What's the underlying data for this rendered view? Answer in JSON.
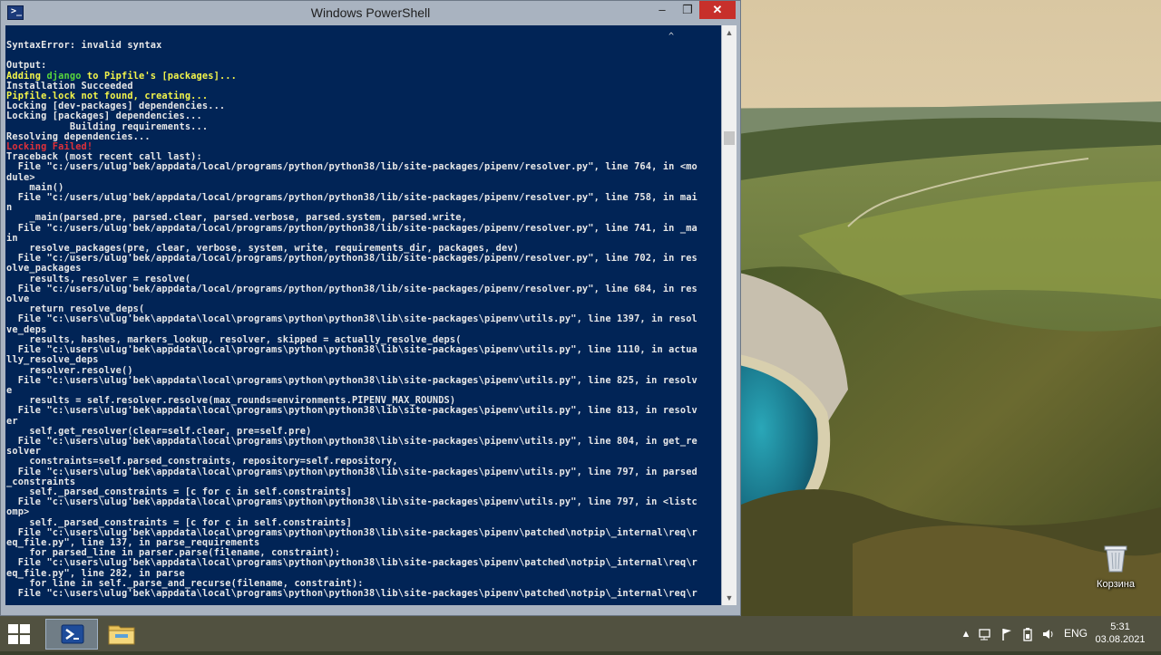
{
  "window": {
    "title": "Windows PowerShell",
    "minimize": "–",
    "maximize": "❐",
    "close": "✕"
  },
  "console": {
    "caret": "^",
    "lines": [
      {
        "text": "SyntaxError: invalid syntax",
        "color": "white"
      },
      {
        "text": "",
        "color": "white"
      },
      {
        "text": "Output:",
        "color": "white"
      },
      {
        "parts": [
          {
            "text": "Adding ",
            "color": "yellow"
          },
          {
            "text": "django",
            "color": "green"
          },
          {
            "text": " to Pipfile's [packages]...",
            "color": "yellow"
          }
        ]
      },
      {
        "text": "Installation Succeeded",
        "color": "white"
      },
      {
        "text": "Pipfile.lock not found, creating...",
        "color": "yellow"
      },
      {
        "text": "Locking [dev-packages] dependencies...",
        "color": "white"
      },
      {
        "text": "Locking [packages] dependencies...",
        "color": "white"
      },
      {
        "text": "           Building requirements...",
        "color": "white"
      },
      {
        "text": "Resolving dependencies...",
        "color": "white"
      },
      {
        "text": "Locking Failed!",
        "color": "red"
      },
      {
        "text": "Traceback (most recent call last):",
        "color": "white"
      },
      {
        "text": "  File \"c:/users/ulug'bek/appdata/local/programs/python/python38/lib/site-packages/pipenv/resolver.py\", line 764, in <mo",
        "color": "white"
      },
      {
        "text": "dule>",
        "color": "white"
      },
      {
        "text": "    main()",
        "color": "white"
      },
      {
        "text": "  File \"c:/users/ulug'bek/appdata/local/programs/python/python38/lib/site-packages/pipenv/resolver.py\", line 758, in mai",
        "color": "white"
      },
      {
        "text": "n",
        "color": "white"
      },
      {
        "text": "    _main(parsed.pre, parsed.clear, parsed.verbose, parsed.system, parsed.write,",
        "color": "white"
      },
      {
        "text": "  File \"c:/users/ulug'bek/appdata/local/programs/python/python38/lib/site-packages/pipenv/resolver.py\", line 741, in _ma",
        "color": "white"
      },
      {
        "text": "in",
        "color": "white"
      },
      {
        "text": "    resolve_packages(pre, clear, verbose, system, write, requirements_dir, packages, dev)",
        "color": "white"
      },
      {
        "text": "  File \"c:/users/ulug'bek/appdata/local/programs/python/python38/lib/site-packages/pipenv/resolver.py\", line 702, in res",
        "color": "white"
      },
      {
        "text": "olve_packages",
        "color": "white"
      },
      {
        "text": "    results, resolver = resolve(",
        "color": "white"
      },
      {
        "text": "  File \"c:/users/ulug'bek/appdata/local/programs/python/python38/lib/site-packages/pipenv/resolver.py\", line 684, in res",
        "color": "white"
      },
      {
        "text": "olve",
        "color": "white"
      },
      {
        "text": "    return resolve_deps(",
        "color": "white"
      },
      {
        "text": "  File \"c:\\users\\ulug'bek\\appdata\\local\\programs\\python\\python38\\lib\\site-packages\\pipenv\\utils.py\", line 1397, in resol",
        "color": "white"
      },
      {
        "text": "ve_deps",
        "color": "white"
      },
      {
        "text": "    results, hashes, markers_lookup, resolver, skipped = actually_resolve_deps(",
        "color": "white"
      },
      {
        "text": "  File \"c:\\users\\ulug'bek\\appdata\\local\\programs\\python\\python38\\lib\\site-packages\\pipenv\\utils.py\", line 1110, in actua",
        "color": "white"
      },
      {
        "text": "lly_resolve_deps",
        "color": "white"
      },
      {
        "text": "    resolver.resolve()",
        "color": "white"
      },
      {
        "text": "  File \"c:\\users\\ulug'bek\\appdata\\local\\programs\\python\\python38\\lib\\site-packages\\pipenv\\utils.py\", line 825, in resolv",
        "color": "white"
      },
      {
        "text": "e",
        "color": "white"
      },
      {
        "text": "    results = self.resolver.resolve(max_rounds=environments.PIPENV_MAX_ROUNDS)",
        "color": "white"
      },
      {
        "text": "  File \"c:\\users\\ulug'bek\\appdata\\local\\programs\\python\\python38\\lib\\site-packages\\pipenv\\utils.py\", line 813, in resolv",
        "color": "white"
      },
      {
        "text": "er",
        "color": "white"
      },
      {
        "text": "    self.get_resolver(clear=self.clear, pre=self.pre)",
        "color": "white"
      },
      {
        "text": "  File \"c:\\users\\ulug'bek\\appdata\\local\\programs\\python\\python38\\lib\\site-packages\\pipenv\\utils.py\", line 804, in get_re",
        "color": "white"
      },
      {
        "text": "solver",
        "color": "white"
      },
      {
        "text": "    constraints=self.parsed_constraints, repository=self.repository,",
        "color": "white"
      },
      {
        "text": "  File \"c:\\users\\ulug'bek\\appdata\\local\\programs\\python\\python38\\lib\\site-packages\\pipenv\\utils.py\", line 797, in parsed",
        "color": "white"
      },
      {
        "text": "_constraints",
        "color": "white"
      },
      {
        "text": "    self._parsed_constraints = [c for c in self.constraints]",
        "color": "white"
      },
      {
        "text": "  File \"c:\\users\\ulug'bek\\appdata\\local\\programs\\python\\python38\\lib\\site-packages\\pipenv\\utils.py\", line 797, in <listc",
        "color": "white"
      },
      {
        "text": "omp>",
        "color": "white"
      },
      {
        "text": "    self._parsed_constraints = [c for c in self.constraints]",
        "color": "white"
      },
      {
        "text": "  File \"c:\\users\\ulug'bek\\appdata\\local\\programs\\python\\python38\\lib\\site-packages\\pipenv\\patched\\notpip\\_internal\\req\\r",
        "color": "white"
      },
      {
        "text": "eq_file.py\", line 137, in parse_requirements",
        "color": "white"
      },
      {
        "text": "    for parsed_line in parser.parse(filename, constraint):",
        "color": "white"
      },
      {
        "text": "  File \"c:\\users\\ulug'bek\\appdata\\local\\programs\\python\\python38\\lib\\site-packages\\pipenv\\patched\\notpip\\_internal\\req\\r",
        "color": "white"
      },
      {
        "text": "eq_file.py\", line 282, in parse",
        "color": "white"
      },
      {
        "text": "    for line in self._parse_and_recurse(filename, constraint):",
        "color": "white"
      },
      {
        "text": "  File \"c:\\users\\ulug'bek\\appdata\\local\\programs\\python\\python38\\lib\\site-packages\\pipenv\\patched\\notpip\\_internal\\req\\r",
        "color": "white"
      }
    ]
  },
  "desktop": {
    "recycle_bin_label": "Корзина"
  },
  "taskbar": {
    "apps": [
      {
        "name": "Windows PowerShell",
        "icon": "powershell-icon",
        "active": true
      },
      {
        "name": "File Explorer",
        "icon": "folder-icon",
        "active": false
      }
    ],
    "tray": {
      "chevron": "▲",
      "language": "ENG",
      "time": "5:31",
      "date": "03.08.2021"
    }
  },
  "colors": {
    "console_bg": "#012456",
    "console_text": "#e8e8e8",
    "yellow": "#f5f54a",
    "green": "#58d63c",
    "red": "#e0303a",
    "close_button": "#c7302b",
    "titlebar": "#a9b3c0"
  }
}
